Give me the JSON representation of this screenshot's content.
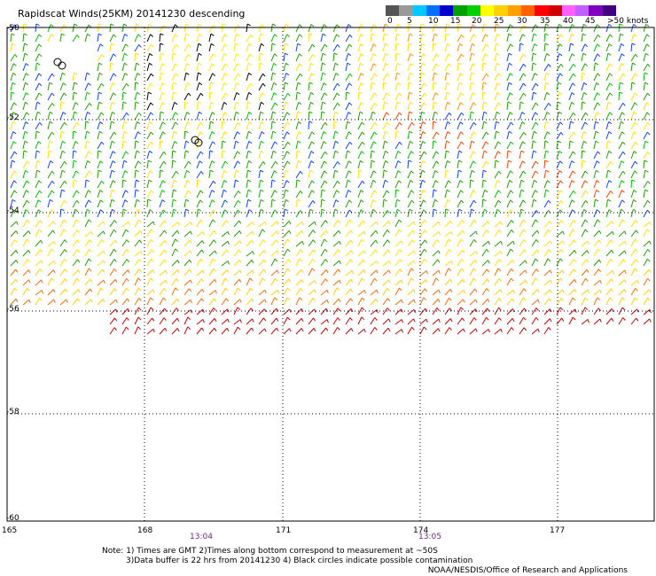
{
  "title": "Rapidscat Winds(25KM) 20141230 descending",
  "colorbar": {
    "labels": [
      "0",
      "5",
      "10",
      "15",
      "20",
      "25",
      "30",
      "35",
      "40",
      "45",
      ">50 knots"
    ],
    "colors": [
      "#555555",
      "#999999",
      "#00c8ff",
      "#0070ff",
      "#0000cc",
      "#00a000",
      "#00d000",
      "#ffff00",
      "#ffd000",
      "#ffa000",
      "#ff6000",
      "#ff0000",
      "#d00000",
      "#ff60ff",
      "#c060ff",
      "#8000c0",
      "#400080"
    ]
  },
  "map": {
    "lat_labels": [
      "-50",
      "-52",
      "-54",
      "-56",
      "-58",
      "-60"
    ],
    "lon_labels": [
      "165",
      "168",
      "171",
      "174",
      "177"
    ],
    "time_labels": [
      "13:04",
      "13:05"
    ]
  },
  "notes": {
    "line1": "Note: 1) Times are GMT 2)Times along bottom correspond to measurement at ~50S",
    "line2": "3)Data buffer is 22 hrs from 20141230 4) Black circles indicate possible contamination"
  },
  "credit": "NOAA/NESDIS/Office of Research and Applications"
}
